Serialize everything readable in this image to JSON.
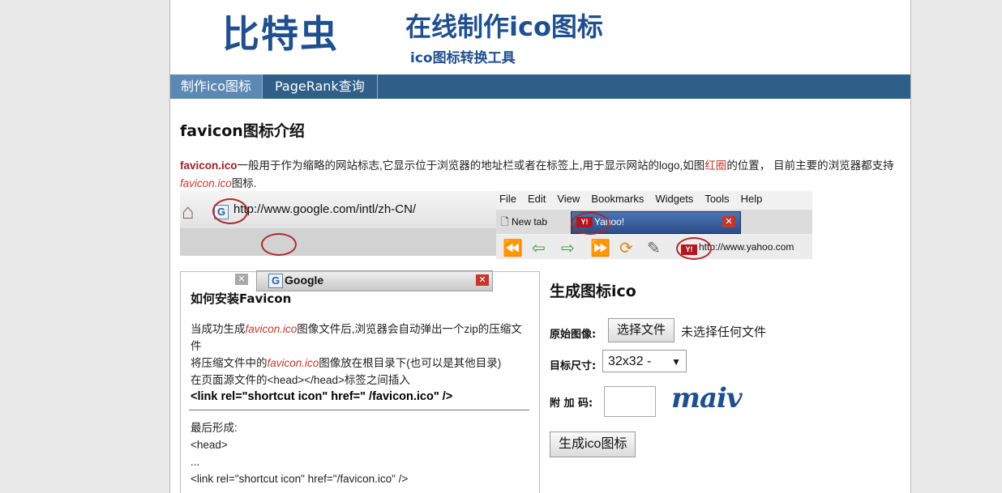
{
  "header": {
    "logo": "比特虫",
    "title": "在线制作ico图标",
    "subtitle": "ico图标转换工具"
  },
  "nav": {
    "items": [
      {
        "label": "制作ico图标",
        "active": true
      },
      {
        "label": "PageRank查询",
        "active": false
      }
    ]
  },
  "intro": {
    "heading": "favicon图标介绍",
    "term": "favicon.ico",
    "text1": "一般用于作为缩略的网站标志,它显示位于浏览器的地址栏或者在标签上,用于显示网站的logo,如图",
    "red_circle": "红圈",
    "text2": "的位置， 目前主要的浏览器都支持",
    "italic_term": "favicon.ico",
    "text3": "图标."
  },
  "demo": {
    "google": {
      "url": "http://www.google.com/intl/zh-CN/",
      "tab_label": "Google",
      "favicon": "G"
    },
    "yahoo": {
      "menu": [
        "File",
        "Edit",
        "View",
        "Bookmarks",
        "Widgets",
        "Tools",
        "Help"
      ],
      "new_tab": "New tab",
      "tab_label": "Yahoo!",
      "favicon": "Y!",
      "url": "http://www.yahoo.com"
    }
  },
  "install": {
    "heading": "如何安装Favicon",
    "line1a": "当成功生成",
    "line1_italic": "favicon.ico",
    "line1b": "图像文件后,浏览器会自动弹出一个zip的压缩文件",
    "line2a": "将压缩文件中的",
    "line2_italic": "favicon.ico",
    "line2b": "图像放在根目录下(也可以是其他目录)",
    "line3": "在页面源文件的<head></head>标签之间插入",
    "snippet": "<link rel=\"shortcut icon\" href=\" /favicon.ico\" />",
    "final_label": "最后形成:",
    "code1": "<head>",
    "code2": "...",
    "code3": "<link rel=\"shortcut icon\" href=\"/favicon.ico\" />"
  },
  "form": {
    "heading": "生成图标ico",
    "source_label": "原始图像:",
    "choose_file": "选择文件",
    "no_file": "未选择任何文件",
    "size_label": "目标尺寸:",
    "size_value": "32x32 -",
    "captcha_label": "附 加 码:",
    "captcha_text": "maiv",
    "submit": "生成ico图标"
  }
}
